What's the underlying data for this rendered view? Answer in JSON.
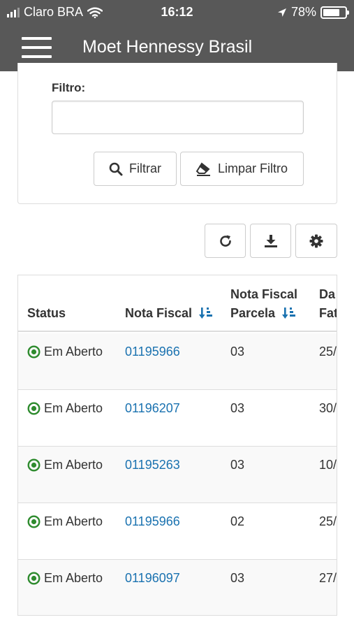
{
  "status_bar": {
    "carrier": "Claro BRA",
    "time": "16:12",
    "battery": "78%",
    "battery_level": 0.78
  },
  "header": {
    "title": "Moet Hennessy Brasil",
    "menu_icon": "hamburger-menu-icon"
  },
  "filter": {
    "label": "Filtro:",
    "value": "",
    "placeholder": "",
    "filter_button": "Filtrar",
    "clear_button": "Limpar Filtro"
  },
  "toolbar": {
    "refresh_icon": "refresh-icon",
    "download_icon": "download-icon",
    "settings_icon": "gear-icon"
  },
  "table": {
    "columns": {
      "status": "Status",
      "nota_fiscal": "Nota Fiscal",
      "parcela_line1": "Nota Fiscal",
      "parcela_line2": "Parcela",
      "data_line1": "Da",
      "data_line2": "Fat"
    },
    "rows": [
      {
        "status": "Em Aberto",
        "nota_fiscal": "01195966",
        "parcela": "03",
        "data": "25/"
      },
      {
        "status": "Em Aberto",
        "nota_fiscal": "01196207",
        "parcela": "03",
        "data": "30/"
      },
      {
        "status": "Em Aberto",
        "nota_fiscal": "01195263",
        "parcela": "03",
        "data": "10/"
      },
      {
        "status": "Em Aberto",
        "nota_fiscal": "01195966",
        "parcela": "02",
        "data": "25/"
      },
      {
        "status": "Em Aberto",
        "nota_fiscal": "01196097",
        "parcela": "03",
        "data": "27/"
      }
    ]
  },
  "colors": {
    "header_bg": "#585858",
    "link": "#1a72b0",
    "status_open": "#2e8b2e",
    "sort_icon": "#1a72b0"
  }
}
